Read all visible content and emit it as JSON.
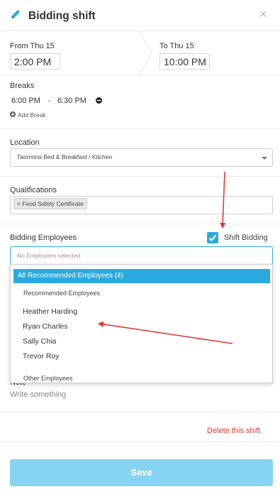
{
  "header": {
    "title": "Bidding shift",
    "close_glyph": "×",
    "pencil_icon": "pencil-icon",
    "close_icon": "close-icon"
  },
  "time": {
    "from_label": "From Thu 15",
    "from_value": "2:00 PM",
    "to_label": "To Thu 15",
    "to_value": "10:00 PM"
  },
  "breaks": {
    "label": "Breaks",
    "start": "6:00 PM",
    "dash": "-",
    "end": "6:30 PM",
    "add_label": "Add Break"
  },
  "location": {
    "label": "Location",
    "value": "Taormina Bed & Breakfast / Kitchen"
  },
  "qualifications": {
    "label": "Qualifications",
    "tags": [
      {
        "remove": "×",
        "label": "Food Safety Certificate"
      }
    ]
  },
  "bidding": {
    "label": "Bidding Employees",
    "shift_bidding_label": "Shift Bidding",
    "shift_bidding_checked": true,
    "placeholder": "No Employees selected"
  },
  "dropdown": {
    "highlighted": "All Recommended Employees (4)",
    "recommended_group": "Recommended Employees",
    "employees": [
      "Heather Harding",
      "Ryan Charles",
      "Sally Chia",
      "Trevor Roy"
    ],
    "other_group": "Other Employees"
  },
  "note": {
    "label": "Note",
    "placeholder": "Write something"
  },
  "actions": {
    "delete_label": "Delete this shift",
    "save_label": "Save"
  },
  "colors": {
    "accent": "#29a9e0",
    "save_bg": "#87d3f2",
    "delete": "#e8352c",
    "annotation_arrow": "#e0312a"
  }
}
